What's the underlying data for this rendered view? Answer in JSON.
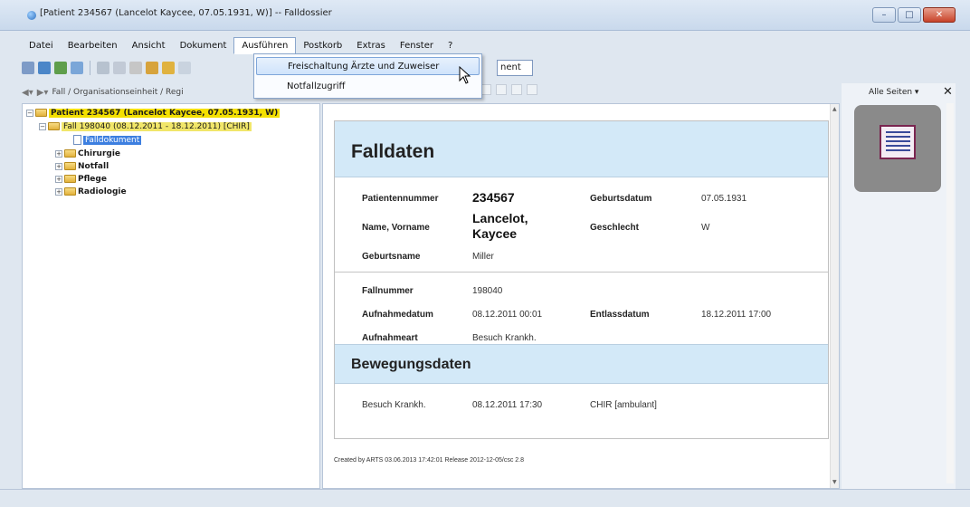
{
  "window": {
    "title": "[Patient 234567 (Lancelot Kaycee, 07.05.1931, W)] -- Falldossier",
    "controls": [
      "–",
      "□",
      "✕"
    ]
  },
  "menubar": [
    "Datei",
    "Bearbeiten",
    "Ansicht",
    "Dokument",
    "Ausführen",
    "Postkorb",
    "Extras",
    "Fenster",
    "?"
  ],
  "dropdown": {
    "items": [
      "Freischaltung Ärzte und Zuweiser",
      "Notfallzugriff"
    ]
  },
  "toolbar": {
    "combo_tail": "nent"
  },
  "navbar": {
    "breadcrumb": "Fall / Organisationseinheit / Regi"
  },
  "tree": {
    "patient": "Patient 234567 (Lancelot Kaycee, 07.05.1931, W)",
    "fall": "Fall 198040 (08.12.2011 - 18.12.2011) [CHIR]",
    "falldokument": "Falldokument",
    "folders": [
      "Chirurgie",
      "Notfall",
      "Pflege",
      "Radiologie"
    ]
  },
  "document": {
    "falldaten_title": "Falldaten",
    "patient": {
      "patientennummer_label": "Patientennummer",
      "patientennummer": "234567",
      "geburtsdatum_label": "Geburtsdatum",
      "geburtsdatum": "07.05.1931",
      "name_label": "Name, Vorname",
      "name_line1": "Lancelot,",
      "name_line2": "Kaycee",
      "geschlecht_label": "Geschlecht",
      "geschlecht": "W",
      "geburtsname_label": "Geburtsname",
      "geburtsname": "Miller"
    },
    "fall": {
      "fallnummer_label": "Fallnummer",
      "fallnummer": "198040",
      "aufnahmedatum_label": "Aufnahmedatum",
      "aufnahmedatum": "08.12.2011 00:01",
      "entlassdatum_label": "Entlassdatum",
      "entlassdatum": "18.12.2011 17:00",
      "aufnahmeart_label": "Aufnahmeart",
      "aufnahmeart": "Besuch Krankh."
    },
    "bewegung_title": "Bewegungsdaten",
    "bewegung_row": [
      "Besuch Krankh.",
      "08.12.2011 17:30",
      "CHIR [ambulant]"
    ],
    "footer": "Created by ARTS 03.06.2013 17:42:01 Release 2012-12-05/csc 2.8"
  },
  "rightpanel": {
    "header": "Alle Seiten ▾",
    "close": "✕"
  }
}
